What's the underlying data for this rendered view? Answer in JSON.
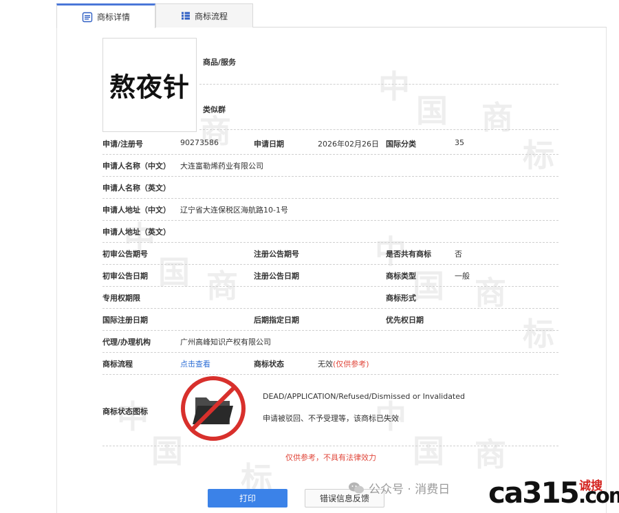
{
  "tabs": [
    {
      "label": "商标详情",
      "active": true
    },
    {
      "label": "商标流程",
      "active": false
    }
  ],
  "mark": {
    "name": "熬夜针",
    "goods_services_label": "商品/服务",
    "similar_group_label": "类似群"
  },
  "fields": {
    "reg_no_label": "申请/注册号",
    "reg_no": "90273586",
    "app_date_label": "申请日期",
    "app_date": "2026年02月26日",
    "intl_class_label": "国际分类",
    "intl_class": "35",
    "applicant_cn_label": "申请人名称（中文）",
    "applicant_cn": "大连富勒烯药业有限公司",
    "applicant_en_label": "申请人名称（英文）",
    "address_cn_label": "申请人地址（中文）",
    "address_cn": "辽宁省大连保税区海航路10-1号",
    "address_en_label": "申请人地址（英文）",
    "prelim_no_label": "初审公告期号",
    "reg_pub_no_label": "注册公告期号",
    "shared_label": "是否共有商标",
    "shared": "否",
    "prelim_date_label": "初审公告日期",
    "reg_pub_date_label": "注册公告日期",
    "mark_type_label": "商标类型",
    "mark_type": "一般",
    "term_label": "专用权期限",
    "mark_form_label": "商标形式",
    "intl_reg_date_label": "国际注册日期",
    "later_date_label": "后期指定日期",
    "priority_date_label": "优先权日期",
    "agent_label": "代理/办理机构",
    "agent": "广州高峰知识产权有限公司",
    "flow_label": "商标流程",
    "flow_link": "点击查看",
    "status_label": "商标状态",
    "status": "无效",
    "status_note": "(仅供参考)",
    "status_icon_label": "商标状态图标",
    "status_en": "DEAD/APPLICATION/Refused/Dismissed or Invalidated",
    "status_cn": "申请被驳回、不予受理等，该商标已失效"
  },
  "disclaimer": "仅供参考，不具有法律效力",
  "buttons": {
    "print": "打印",
    "feedback": "错误信息反馈"
  },
  "watermark": {
    "wechat_text": "公众号 · 消费日",
    "logo_text": "ca315",
    "logo_suffix": "com",
    "logo_cn": "诚搜"
  },
  "colors": {
    "accent": "#3b82e8",
    "warning": "#e0473b",
    "link": "#2f6fd6"
  }
}
